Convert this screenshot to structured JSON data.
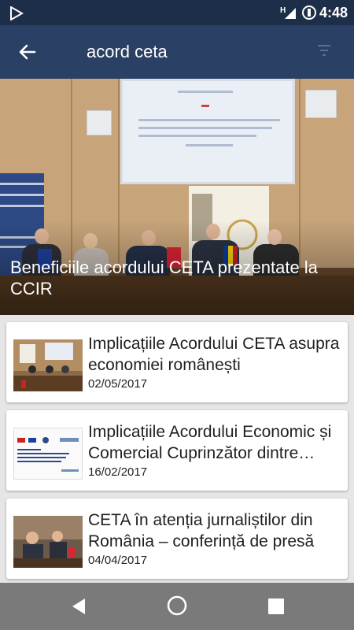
{
  "status_bar": {
    "time": "4:48",
    "network": "H"
  },
  "toolbar": {
    "search_query": "acord ceta"
  },
  "hero": {
    "title": "Beneficiile acordului CETA prezentate la CCIR"
  },
  "articles": [
    {
      "title": "Implicațiile Acordului CETA asupra economiei românești",
      "date": "02/05/2017"
    },
    {
      "title": "Implicațiile Acordului Economic și Comercial Cuprinzător dintre Canada și Uniunea Europeană",
      "date": "16/02/2017"
    },
    {
      "title": "CETA în atenția jurnaliștilor din România – conferință de presă",
      "date": "04/04/2017"
    }
  ]
}
